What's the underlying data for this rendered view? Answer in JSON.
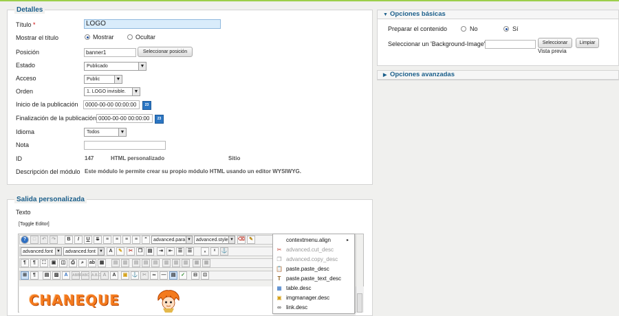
{
  "detalles": {
    "legend": "Detalles",
    "titulo": {
      "label": "Título",
      "required": "*",
      "value": "LOGO"
    },
    "mostrar_titulo": {
      "label": "Mostrar el título",
      "options": [
        "Mostrar",
        "Ocultar"
      ],
      "selected": "Mostrar"
    },
    "posicion": {
      "label": "Posición",
      "value": "banner1",
      "button": "Seleccionar posición"
    },
    "estado": {
      "label": "Estado",
      "value": "Publicado"
    },
    "acceso": {
      "label": "Acceso",
      "value": "Public"
    },
    "orden": {
      "label": "Orden",
      "value": "1. LOGO invisible."
    },
    "inicio": {
      "label": "Inicio de la publicación",
      "value": "0000-00-00 00:00:00"
    },
    "fin": {
      "label": "Finalización de la publicación",
      "value": "0000-00-00 00:00:00"
    },
    "idioma": {
      "label": "Idioma",
      "value": "Todos"
    },
    "nota": {
      "label": "Nota",
      "value": ""
    },
    "id": {
      "label": "ID",
      "value": "147",
      "type": "HTML personalizado",
      "site": "Sitio"
    },
    "descripcion": {
      "label": "Descripción del módulo",
      "value": "Este módulo le permite crear su propio módulo HTML usando un editor WYSIWYG."
    },
    "calendar_icon": "23"
  },
  "salida": {
    "legend": "Salida personalizada",
    "texto_label": "Texto",
    "toggle": "[Toggle Editor]",
    "selects": [
      "advanced.para",
      "advanced.style",
      "advanced.font",
      "advanced.font"
    ],
    "content_logo": "CHANEQUE"
  },
  "context_menu": {
    "items": [
      {
        "label": "contextmenu.align",
        "icon": "",
        "disabled": false,
        "submenu": "▸"
      },
      {
        "label": "advanced.cut_desc",
        "icon": "✂",
        "disabled": true
      },
      {
        "label": "advanced.copy_desc",
        "icon": "❐",
        "disabled": true
      },
      {
        "label": "paste.paste_desc",
        "icon": "📋",
        "disabled": false
      },
      {
        "label": "paste.paste_text_desc",
        "icon": "T",
        "disabled": false
      },
      {
        "label": "table.desc",
        "icon": "▦",
        "disabled": false
      },
      {
        "label": "imgmanager.desc",
        "icon": "▣",
        "disabled": false
      },
      {
        "label": "link.desc",
        "icon": "∞",
        "disabled": false
      }
    ]
  },
  "opciones_basicas": {
    "title": "Opciones básicas",
    "preparar": {
      "label": "Preparar el contenido",
      "options": [
        "No",
        "Sí"
      ],
      "selected": "Sí"
    },
    "background": {
      "label": "Seleccionar un 'Background-Image'",
      "value": "",
      "btn_select": "Seleccionar",
      "btn_clear": "Limpiar",
      "preview": "Vista previa"
    }
  },
  "opciones_avanzadas": {
    "title": "Opciones avanzadas"
  },
  "colors": {
    "accent": "#1a5e8a",
    "topline": "#9ccf4a",
    "required": "#cc0000"
  }
}
